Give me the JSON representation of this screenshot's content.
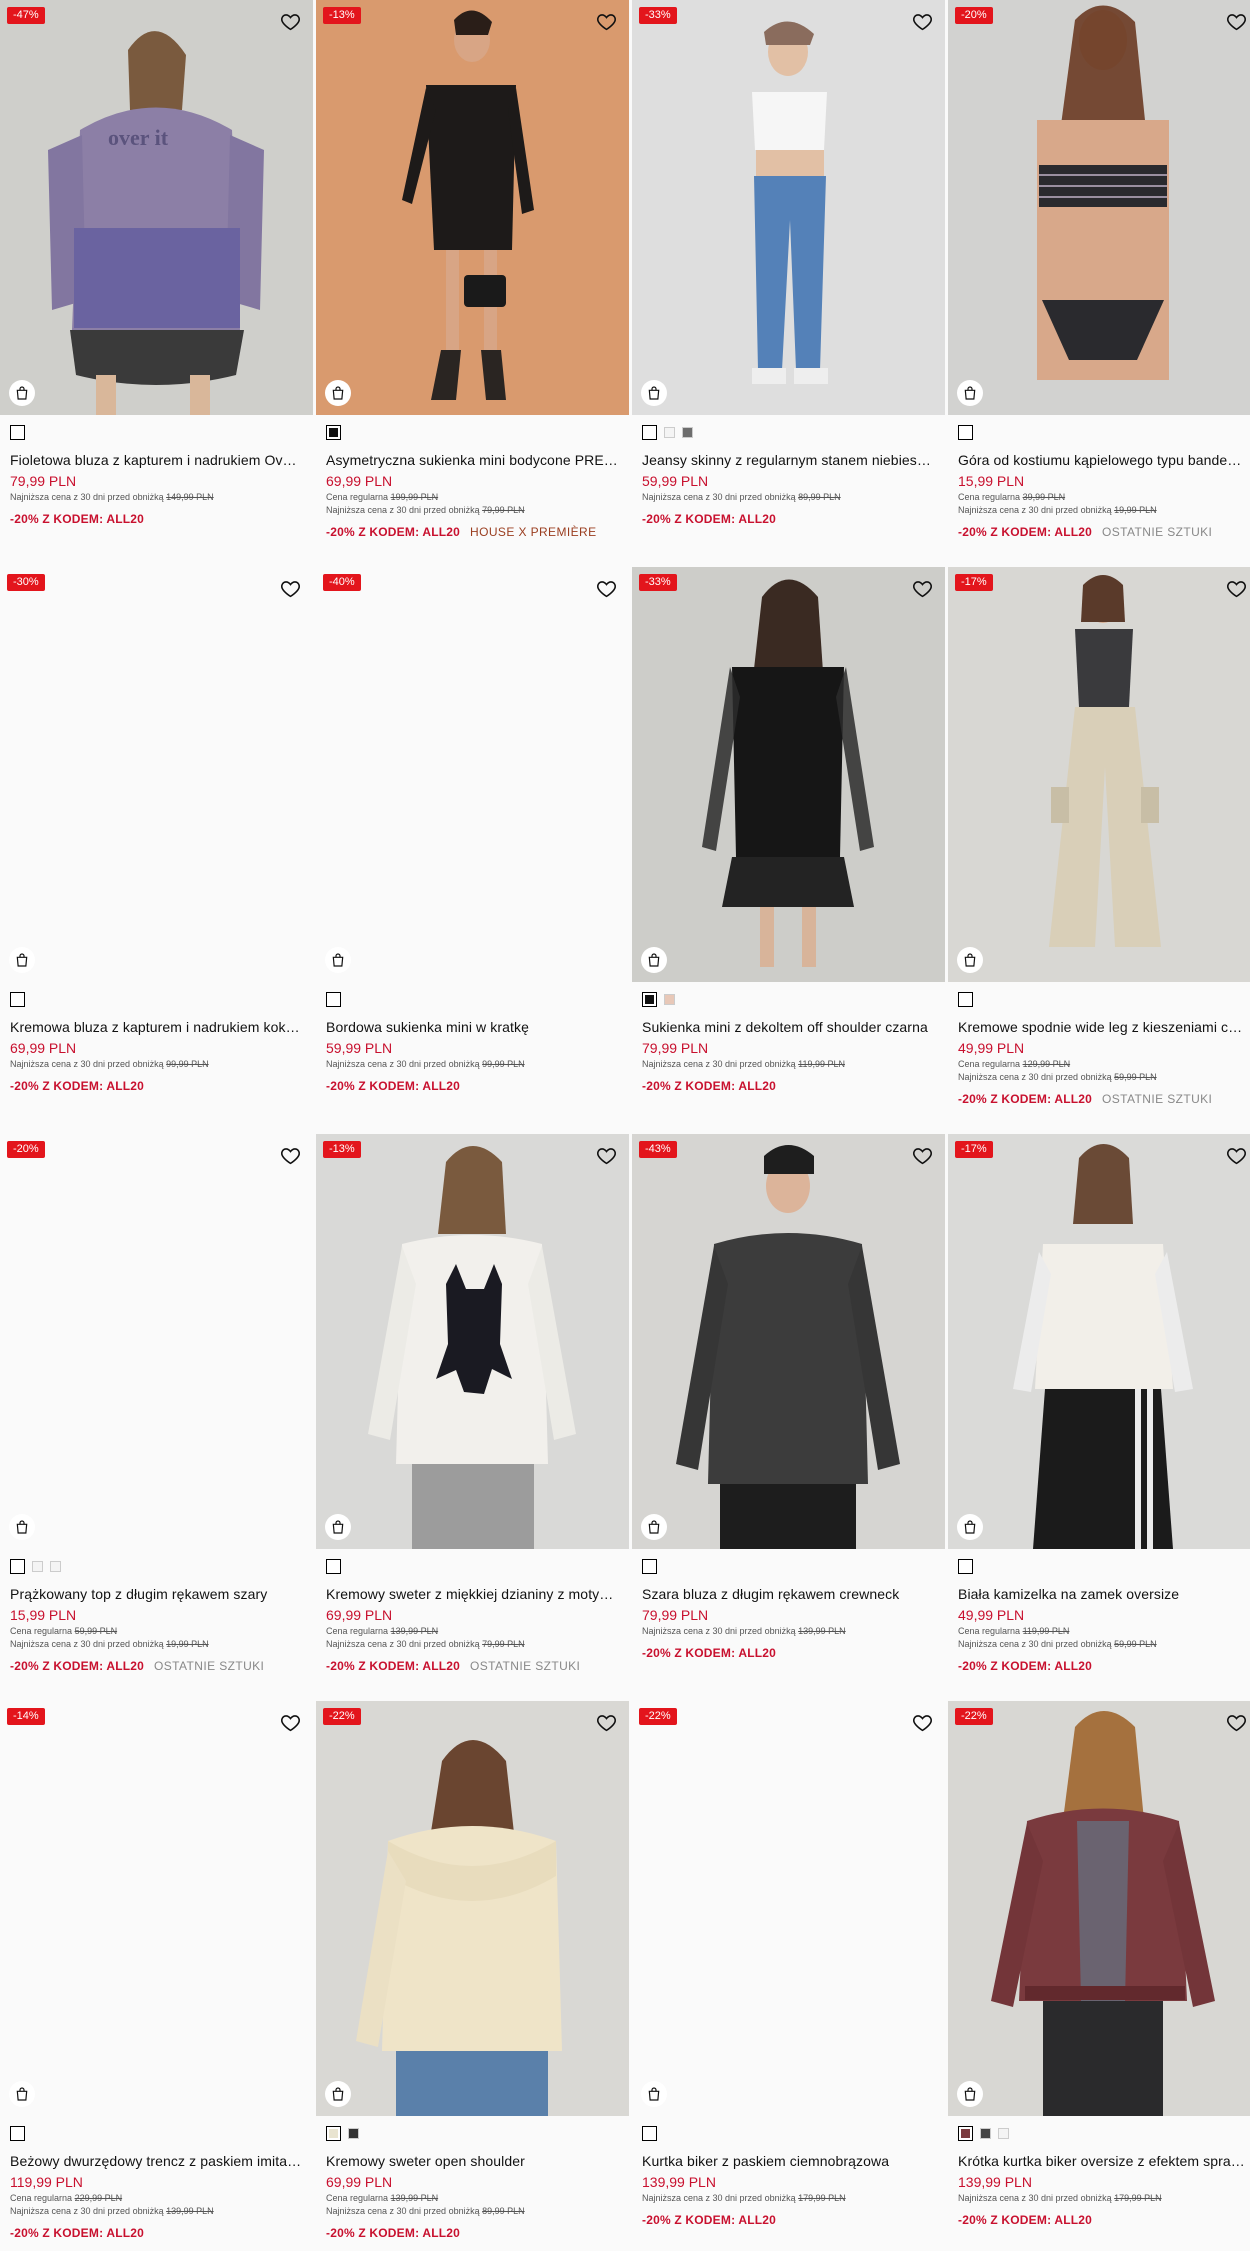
{
  "products": [
    {
      "badge": "-47%",
      "name": "Fioletowa bluza z kapturem i nadrukiem Over it",
      "price": "79,99 PLN",
      "regular": null,
      "lowest_label": "Najniższa cena z 30 dni przed obniżką",
      "lowest": "149,99 PLN",
      "promo": "-20% Z KODEM: ALL20",
      "tag": null,
      "image": "purple-hoodie",
      "swatches": [
        {
          "color": "#ffffff",
          "selected": true
        }
      ]
    },
    {
      "badge": "-13%",
      "name": "Asymetryczna sukienka mini bodycone PREMIÈRE",
      "price": "69,99 PLN",
      "regular_label": "Cena regularna",
      "regular": "199,99 PLN",
      "lowest_label": "Najniższa cena z 30 dni przed obniżką",
      "lowest": "79,99 PLN",
      "promo": "-20% Z KODEM: ALL20",
      "tag": "HOUSE X PREMIÈRE",
      "image": "black-dress",
      "swatches": [
        {
          "color": "#111111",
          "selected": true
        }
      ]
    },
    {
      "badge": "-33%",
      "name": "Jeansy skinny z regularnym stanem niebieskie",
      "price": "59,99 PLN",
      "regular": null,
      "lowest_label": "Najniższa cena z 30 dni przed obniżką",
      "lowest": "89,99 PLN",
      "promo": "-20% Z KODEM: ALL20",
      "tag": null,
      "image": "jeans",
      "swatches": [
        {
          "color": "#ffffff",
          "selected": true
        },
        {
          "color": "#f4f4f4",
          "selected": false
        },
        {
          "color": "#6d6d6d",
          "selected": false
        }
      ]
    },
    {
      "badge": "-20%",
      "name": "Góra od kostiumu kąpielowego typu bandeau w paski",
      "price": "15,99 PLN",
      "regular_label": "Cena regularna",
      "regular": "39,99 PLN",
      "lowest_label": "Najniższa cena z 30 dni przed obniżką",
      "lowest": "19,99 PLN",
      "promo": "-20% Z KODEM: ALL20",
      "tag": "OSTATNIE SZTUKI",
      "image": "bikini",
      "swatches": [
        {
          "color": "#ffffff",
          "selected": true
        }
      ]
    },
    {
      "badge": "-30%",
      "name": "Kremowa bluza z kapturem i nadrukiem kokardki",
      "price": "69,99 PLN",
      "regular": null,
      "lowest_label": "Najniższa cena z 30 dni przed obniżką",
      "lowest": "99,99 PLN",
      "promo": "-20% Z KODEM: ALL20",
      "tag": null,
      "image": "empty",
      "swatches": [
        {
          "color": "#ffffff",
          "selected": true
        }
      ]
    },
    {
      "badge": "-40%",
      "name": "Bordowa sukienka mini w kratkę",
      "price": "59,99 PLN",
      "regular": null,
      "lowest_label": "Najniższa cena z 30 dni przed obniżką",
      "lowest": "99,99 PLN",
      "promo": "-20% Z KODEM: ALL20",
      "tag": null,
      "image": "empty",
      "swatches": [
        {
          "color": "#ffffff",
          "selected": true
        }
      ]
    },
    {
      "badge": "-33%",
      "name": "Sukienka mini z dekoltem off shoulder czarna",
      "price": "79,99 PLN",
      "regular": null,
      "lowest_label": "Najniższa cena z 30 dni przed obniżką",
      "lowest": "119,99 PLN",
      "promo": "-20% Z KODEM: ALL20",
      "tag": null,
      "image": "mesh-dress",
      "swatches": [
        {
          "color": "#111111",
          "selected": true
        },
        {
          "color": "#e8c8b8",
          "selected": false
        }
      ]
    },
    {
      "badge": "-17%",
      "name": "Kremowe spodnie wide leg z kieszeniami cargo",
      "price": "49,99 PLN",
      "regular_label": "Cena regularna",
      "regular": "129,99 PLN",
      "lowest_label": "Najniższa cena z 30 dni przed obniżką",
      "lowest": "59,99 PLN",
      "promo": "-20% Z KODEM: ALL20",
      "tag": "OSTATNIE SZTUKI",
      "image": "cargo-pants",
      "swatches": [
        {
          "color": "#ffffff",
          "selected": true
        }
      ]
    },
    {
      "badge": "-20%",
      "name": "Prążkowany top z długim rękawem szary",
      "price": "15,99 PLN",
      "regular_label": "Cena regularna",
      "regular": "59,99 PLN",
      "lowest_label": "Najniższa cena z 30 dni przed obniżką",
      "lowest": "19,99 PLN",
      "promo": "-20% Z KODEM: ALL20",
      "tag": "OSTATNIE SZTUKI",
      "image": "empty",
      "swatches": [
        {
          "color": "#ffffff",
          "selected": true
        },
        {
          "color": "#f4f4f4",
          "selected": false
        },
        {
          "color": "#f4f4f4",
          "selected": false
        }
      ]
    },
    {
      "badge": "-13%",
      "name": "Kremowy sweter z miękkiej dzianiny z motywem kota",
      "price": "69,99 PLN",
      "regular_label": "Cena regularna",
      "regular": "139,99 PLN",
      "lowest_label": "Najniższa cena z 30 dni przed obniżką",
      "lowest": "79,99 PLN",
      "promo": "-20% Z KODEM: ALL20",
      "tag": "OSTATNIE SZTUKI",
      "image": "cat-sweater",
      "swatches": [
        {
          "color": "#ffffff",
          "selected": true
        }
      ]
    },
    {
      "badge": "-43%",
      "name": "Szara bluza z długim rękawem crewneck",
      "price": "79,99 PLN",
      "regular": null,
      "lowest_label": "Najniższa cena z 30 dni przed obniżką",
      "lowest": "139,99 PLN",
      "promo": "-20% Z KODEM: ALL20",
      "tag": null,
      "image": "grey-sweatshirt",
      "swatches": [
        {
          "color": "#ffffff",
          "selected": true
        }
      ]
    },
    {
      "badge": "-17%",
      "name": "Biała kamizelka na zamek oversize",
      "price": "49,99 PLN",
      "regular_label": "Cena regularna",
      "regular": "119,99 PLN",
      "lowest_label": "Najniższa cena z 30 dni przed obniżką",
      "lowest": "59,99 PLN",
      "promo": "-20% Z KODEM: ALL20",
      "tag": null,
      "image": "white-vest",
      "swatches": [
        {
          "color": "#ffffff",
          "selected": true
        }
      ]
    },
    {
      "badge": "-14%",
      "name": "Beżowy dwurzędowy trencz z paskiem imitacja skóry",
      "price": "119,99 PLN",
      "regular_label": "Cena regularna",
      "regular": "229,99 PLN",
      "lowest_label": "Najniższa cena z 30 dni przed obniżką",
      "lowest": "139,99 PLN",
      "promo": "-20% Z KODEM: ALL20",
      "tag": null,
      "image": "empty",
      "swatches": [
        {
          "color": "#ffffff",
          "selected": true
        }
      ]
    },
    {
      "badge": "-22%",
      "name": "Kremowy sweter open shoulder",
      "price": "69,99 PLN",
      "regular_label": "Cena regularna",
      "regular": "139,99 PLN",
      "lowest_label": "Najniższa cena z 30 dni przed obniżką",
      "lowest": "89,99 PLN",
      "promo": "-20% Z KODEM: ALL20",
      "tag": null,
      "image": "cream-sweater",
      "swatches": [
        {
          "color": "#e9e4d0",
          "selected": true
        },
        {
          "color": "#333333",
          "selected": false
        }
      ]
    },
    {
      "badge": "-22%",
      "name": "Kurtka biker z paskiem ciemnobrązowa",
      "price": "139,99 PLN",
      "regular": null,
      "lowest_label": "Najniższa cena z 30 dni przed obniżką",
      "lowest": "179,99 PLN",
      "promo": "-20% Z KODEM: ALL20",
      "tag": null,
      "image": "empty",
      "swatches": [
        {
          "color": "#ffffff",
          "selected": true
        }
      ]
    },
    {
      "badge": "-22%",
      "name": "Krótka kurtka biker oversize z efektem sprania",
      "price": "139,99 PLN",
      "regular": null,
      "lowest_label": "Najniższa cena z 30 dni przed obniżką",
      "lowest": "179,99 PLN",
      "promo": "-20% Z KODEM: ALL20",
      "tag": null,
      "image": "biker-jacket",
      "swatches": [
        {
          "color": "#7a3a3e",
          "selected": true
        },
        {
          "color": "#444444",
          "selected": false
        },
        {
          "color": "#f4f4f4",
          "selected": false
        }
      ]
    }
  ],
  "colors": {
    "badge": "#e3151c",
    "price": "#c8102e",
    "tag_house": "#9a3d1f"
  },
  "icons": {
    "wishlist": "heart-icon",
    "quick_add": "shopping-bag-icon"
  }
}
